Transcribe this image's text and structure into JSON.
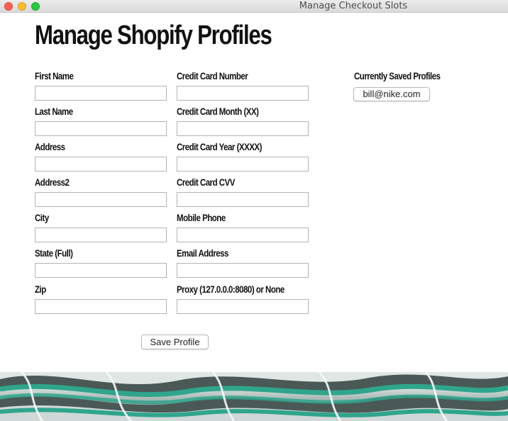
{
  "window": {
    "title": "Manage Checkout Slots"
  },
  "page": {
    "title": "Manage Shopify Profiles"
  },
  "form": {
    "left_fields": [
      {
        "label": "First Name",
        "value": ""
      },
      {
        "label": "Last Name",
        "value": ""
      },
      {
        "label": "Address",
        "value": ""
      },
      {
        "label": "Address2",
        "value": ""
      },
      {
        "label": "City",
        "value": ""
      },
      {
        "label": "State (Full)",
        "value": ""
      },
      {
        "label": "Zip",
        "value": ""
      }
    ],
    "right_fields": [
      {
        "label": "Credit Card Number",
        "value": ""
      },
      {
        "label": "Credit Card Month (XX)",
        "value": ""
      },
      {
        "label": "Credit Card Year (XXXX)",
        "value": ""
      },
      {
        "label": "Credit Card CVV",
        "value": ""
      },
      {
        "label": "Mobile Phone",
        "value": ""
      },
      {
        "label": "Email Address",
        "value": ""
      },
      {
        "label": "Proxy (127.0.0.0:8080) or None",
        "value": ""
      }
    ],
    "save_label": "Save Profile"
  },
  "saved_profiles": {
    "label": "Currently Saved Profiles",
    "items": [
      "bill@nike.com"
    ]
  },
  "colors": {
    "close": "#fc5f57",
    "minimize": "#fdbc2e",
    "maximize": "#28c840",
    "background_image_teal": "#2fa58c"
  },
  "background": {
    "icon": "sneaker-photo"
  }
}
